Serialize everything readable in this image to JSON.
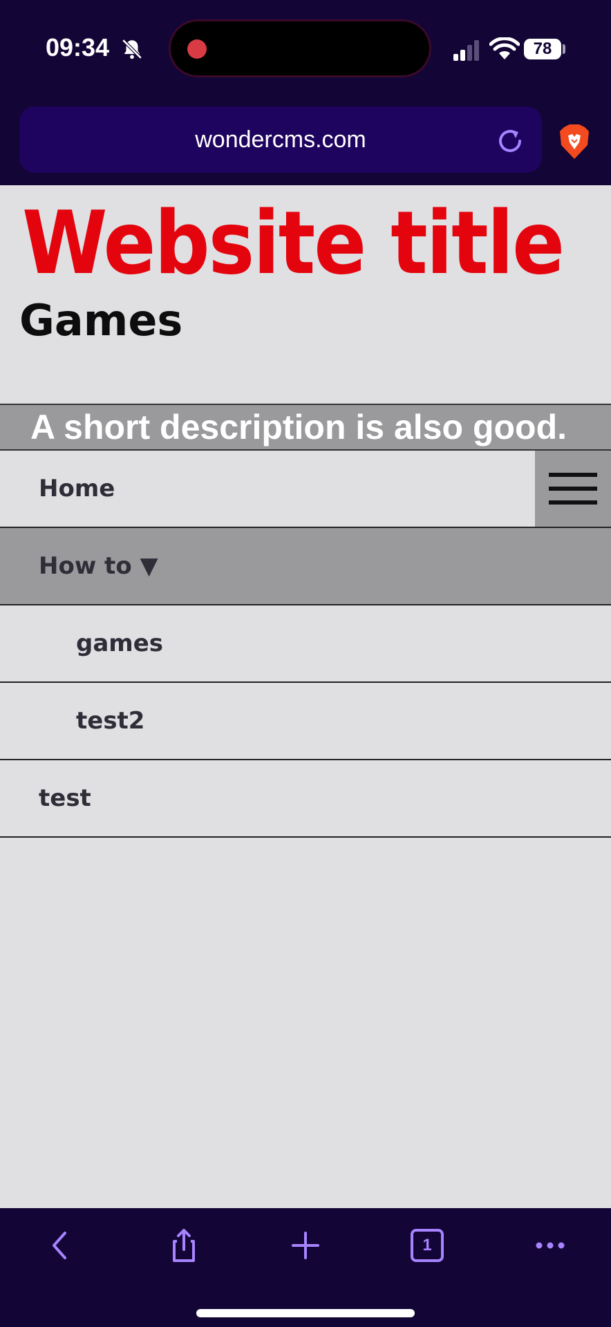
{
  "status_bar": {
    "time": "09:34",
    "battery": "78"
  },
  "browser": {
    "url": "wondercms.com"
  },
  "site": {
    "title": "Website title",
    "page_title": "Games",
    "description": "A short description is also good."
  },
  "nav": {
    "items": [
      {
        "label": "Home"
      },
      {
        "label": "How to ▼"
      },
      {
        "label": "games"
      },
      {
        "label": "test2"
      },
      {
        "label": "test"
      }
    ]
  },
  "toolbar": {
    "tab_count": "1"
  },
  "colors": {
    "title_red": "#e3040e",
    "bar_bg": "#130535",
    "accent_purple": "#a783ff",
    "band_gray": "#9a999c",
    "page_bg": "#e0dfe2"
  }
}
